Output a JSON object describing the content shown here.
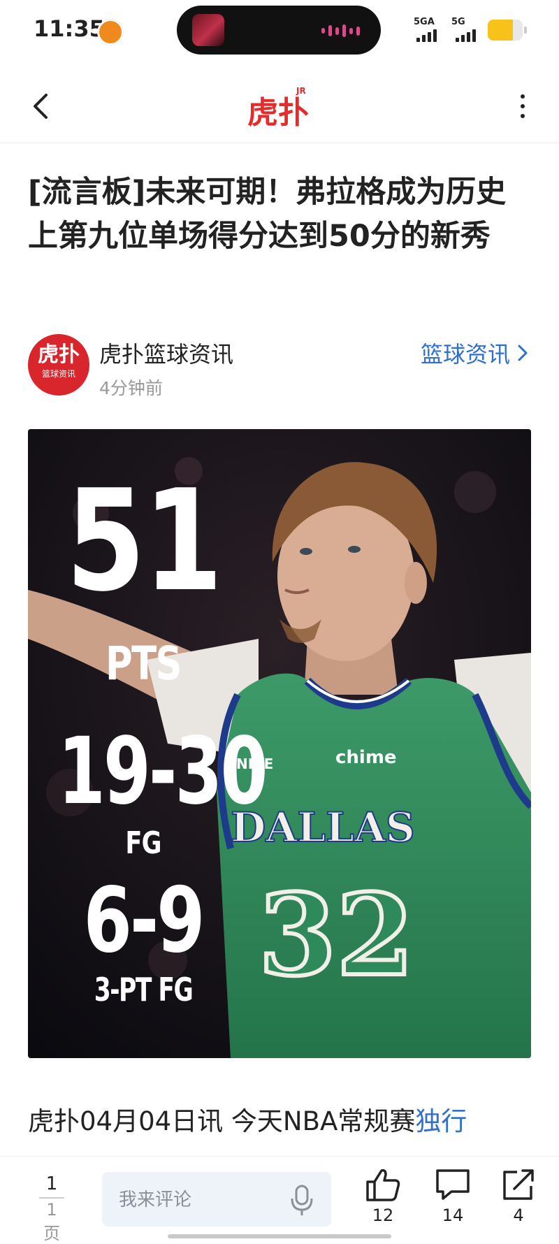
{
  "status_bar": {
    "time": "11:35",
    "network_1": "5GA",
    "network_2": "5G",
    "accent_color": "#f7c21a"
  },
  "nav": {
    "brand_text": "虎扑",
    "brand_superscript": "JR",
    "brand_color": "#e52b2b",
    "back_icon": "chevron-left-icon",
    "more_icon": "more-vertical-icon"
  },
  "article": {
    "title": "[流言板]未来可期！弗拉格成为历史上第九位单场得分达到50分的新秀",
    "author": {
      "name": "虎扑篮球资讯",
      "avatar_text_big": "虎扑",
      "avatar_text_small": "篮球资讯",
      "time": "4分钟前"
    },
    "category_link": "篮球资讯",
    "body_start": "虎扑04月04日讯 今天NBA常规赛",
    "body_highlight": "独行",
    "link_color": "#2f6fcf"
  },
  "hero_image": {
    "stat_pts": "51",
    "stat_pts_label": "PTS",
    "stat_fg": "19-30",
    "stat_fg_label": "FG",
    "stat_3pt": "6-9",
    "stat_3pt_label": "3-PT FG",
    "jersey_team": "DALLAS",
    "jersey_number": "32",
    "jersey_sponsor": "chime",
    "jersey_brand": "NIKE",
    "jersey_color": "#2e8a5a"
  },
  "bottom_bar": {
    "page_current": "1",
    "page_total": "1页",
    "comment_placeholder": "我来评论",
    "likes": "12",
    "comments": "14",
    "shares": "4"
  }
}
